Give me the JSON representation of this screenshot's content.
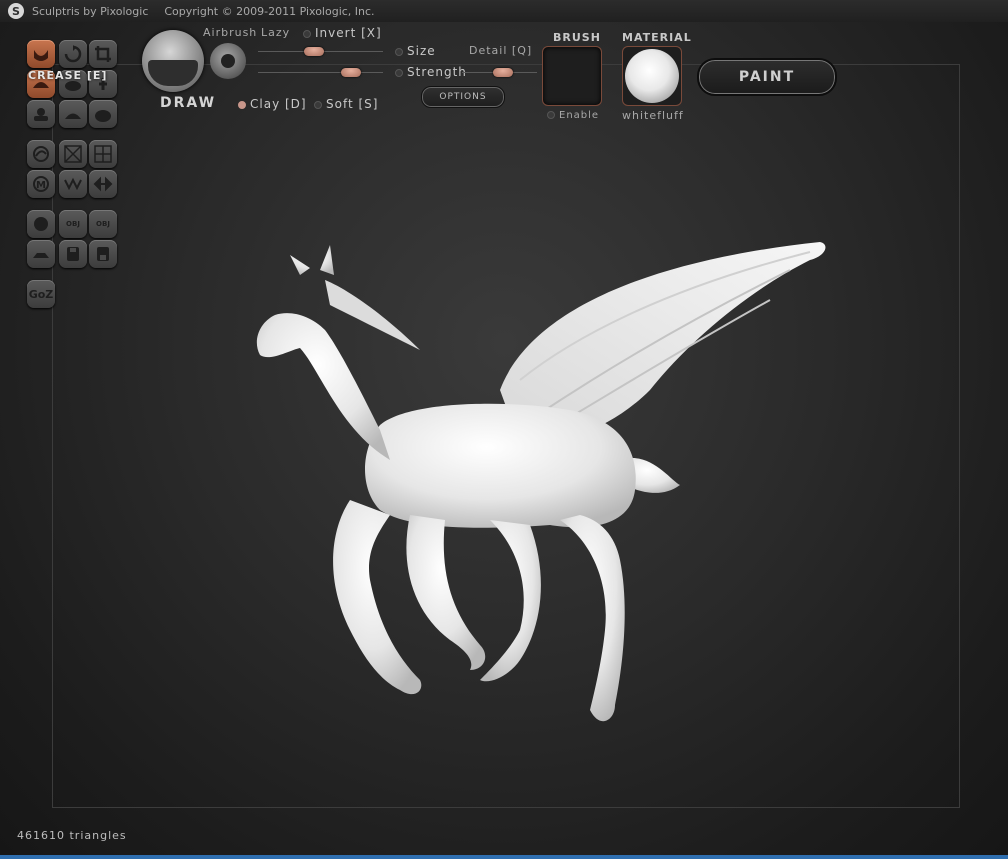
{
  "window": {
    "app_title": "Sculptris by Pixologic",
    "copyright": "Copyright © 2009-2011 Pixologic, Inc."
  },
  "toolbar": {
    "crease_label": "CREASE [E]",
    "goz_label": "GoZ",
    "obj_label": "OBJ"
  },
  "brush": {
    "mode_label": "DRAW",
    "airbrush_label": "Airbrush",
    "lazy_label": "Lazy",
    "invert_label": "Invert [X]",
    "size_label": "Size",
    "strength_label": "Strength",
    "detail_label": "Detail [Q]",
    "clay_label": "Clay [D]",
    "soft_label": "Soft [S]",
    "options_label": "OPTIONS",
    "size_value": 0.45,
    "strength_value": 0.74,
    "detail_value": 0.55
  },
  "brush_panel": {
    "header": "BRUSH",
    "enable_label": "Enable"
  },
  "material_panel": {
    "header": "MATERIAL",
    "name": "whitefluff"
  },
  "paint_button": {
    "label": "PAINT"
  },
  "status": {
    "triangles": "461610 triangles"
  },
  "colors": {
    "accent": "#c8754f",
    "slider_knob": "#d49a86",
    "frame_border": "#3c3c3c",
    "taskbar": "#2f6fb0"
  }
}
